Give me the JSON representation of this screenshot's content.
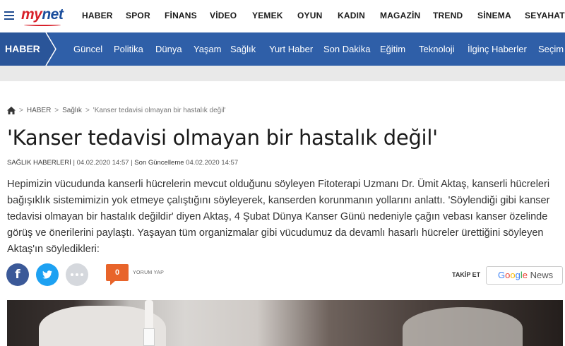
{
  "topnav": {
    "logo": {
      "part1": "my",
      "part2": "net"
    },
    "items": [
      "HABER",
      "SPOR",
      "FİNANS",
      "VİDEO",
      "YEMEK",
      "OYUN",
      "KADIN",
      "MAGAZİN",
      "TREND",
      "SİNEMA",
      "SEYAHAT"
    ]
  },
  "sectionbar": {
    "title": "HABER",
    "items": [
      "Güncel",
      "Politika",
      "Dünya",
      "Yaşam",
      "Sağlık",
      "Yurt Haber",
      "Son Dakika",
      "Eğitim",
      "Teknoloji",
      "İlginç Haberler",
      "Seçim"
    ]
  },
  "breadcrumb": {
    "items": [
      "HABER",
      "Sağlık",
      "'Kanser tedavisi olmayan bir hastalık değil'"
    ],
    "separator": ">"
  },
  "article": {
    "title": "'Kanser tedavisi olmayan bir hastalık değil'",
    "category": "SAĞLIK HABERLERİ",
    "published": "04.02.2020 14:57",
    "updated_label": "Son Güncelleme",
    "updated": "04.02.2020 14:57",
    "summary": "Hepimizin vücudunda kanserli hücrelerin mevcut olduğunu söyleyen Fitoterapi Uzmanı Dr. Ümit Aktaş, kanserli hücreleri bağışıklık sistemimizin yok etmeye çalıştığını söyleyerek, kanserden korunmanın yollarını anlattı. 'Söylendiği gibi kanser tedavisi olmayan bir hastalık değildir' diyen Aktaş, 4 Şubat Dünya Kanser Günü nedeniyle çağın vebası kanser özelinde görüş ve önerilerini paylaştı. Yaşayan tüm organizmalar gibi vücudumuz da devamlı hasarlı hücreler ürettiğini söyleyen Aktaş'ın söyledikleri:"
  },
  "share": {
    "comment_count": "0",
    "comment_label": "YORUM YAP",
    "follow_label": "TAKİP ET",
    "gnews": {
      "g": "G",
      "o1": "o",
      "o2": "o",
      "g2": "g",
      "l": "l",
      "e": "e",
      "news": "News"
    }
  },
  "colors": {
    "brand": "#2f5fa8",
    "accent": "#d8202a",
    "comment": "#e8642a",
    "facebook": "#3b5998",
    "twitter": "#1da1f2"
  },
  "icons": [
    "menu-icon",
    "home-icon",
    "facebook-icon",
    "twitter-icon",
    "more-icon",
    "comment-icon"
  ]
}
